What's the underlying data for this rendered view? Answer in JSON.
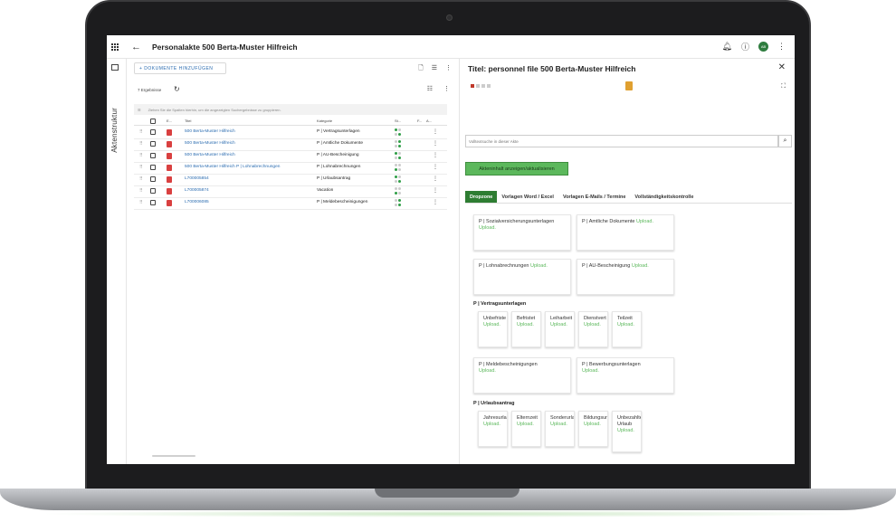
{
  "header": {
    "title": "Personalakte 500 Berta-Muster Hilfreich",
    "avatar": "AB"
  },
  "sidebar": {
    "vertical_label": "Aktenstruktur"
  },
  "left": {
    "add_button": "+ DOKUMENTE HINZUFÜGEN",
    "result_count": "7 Ergebnisse",
    "group_hint": "Ziehen Sie die Spalten hierhin, um die angezeigten Suchergebnisse zu gruppieren.",
    "columns": {
      "e": "E...",
      "title": "Titel",
      "category": "Kategorie",
      "status": "St...",
      "f": "F...",
      "a": "A..."
    },
    "rows": [
      {
        "title": "500 Berta-Muster Hilfreich",
        "category": "P | Vertragsunterlagen"
      },
      {
        "title": "500 Berta-Muster Hilfreich",
        "category": "P | Amtliche Dokumente"
      },
      {
        "title": "500 Berta-Muster Hilfreich",
        "category": "P | AU-Bescheinigung"
      },
      {
        "title": "500 Berta-Muster Hilfreich P | Lohnabrechnungen",
        "category": "P | Lohnabrechnungen"
      },
      {
        "title": "L700005854",
        "category": "P | Urlaubsantrag"
      },
      {
        "title": "L700005874",
        "category": "Vacation"
      },
      {
        "title": "L700006085",
        "category": "P | Meldebescheinigungen"
      }
    ]
  },
  "right": {
    "title": "Titel: personnel file 500 Berta-Muster Hilfreich",
    "search_placeholder": "Volltextsuche in dieser Akte",
    "refresh_button": "Akteninhalt anzeigen/aktualisieren",
    "tabs": [
      "Dropzone",
      "Vorlagen Word / Excel",
      "Vorlagen E-Mails / Termine",
      "Vollständigkeitskontrolle"
    ],
    "upload": "Upload.",
    "cards_top": [
      "P | Sozialversicherungsunterlagen",
      "P | Amtliche Dokumente",
      "P | Lohnabrechnungen",
      "P | AU-Bescheinigung"
    ],
    "sec1": "P | Vertragsunterlagen",
    "vertrag": [
      "Unbefriste",
      "Befristet",
      "Leiharbeit",
      "Dienstvert",
      "Teilzeit"
    ],
    "cards_mid": [
      "P | Meldebescheinigungen",
      "P | Bewerbungsunterlagen"
    ],
    "sec2": "P | Urlaubsantrag",
    "urlaub": [
      "Jahresurla",
      "Elternzeit",
      "Sonderurla",
      "Bildungsur",
      "Unbezahlter Urlaub"
    ]
  },
  "colors": {
    "accent": "#2e7d32",
    "link": "#2b6cb0",
    "button": "#5cb85c"
  }
}
